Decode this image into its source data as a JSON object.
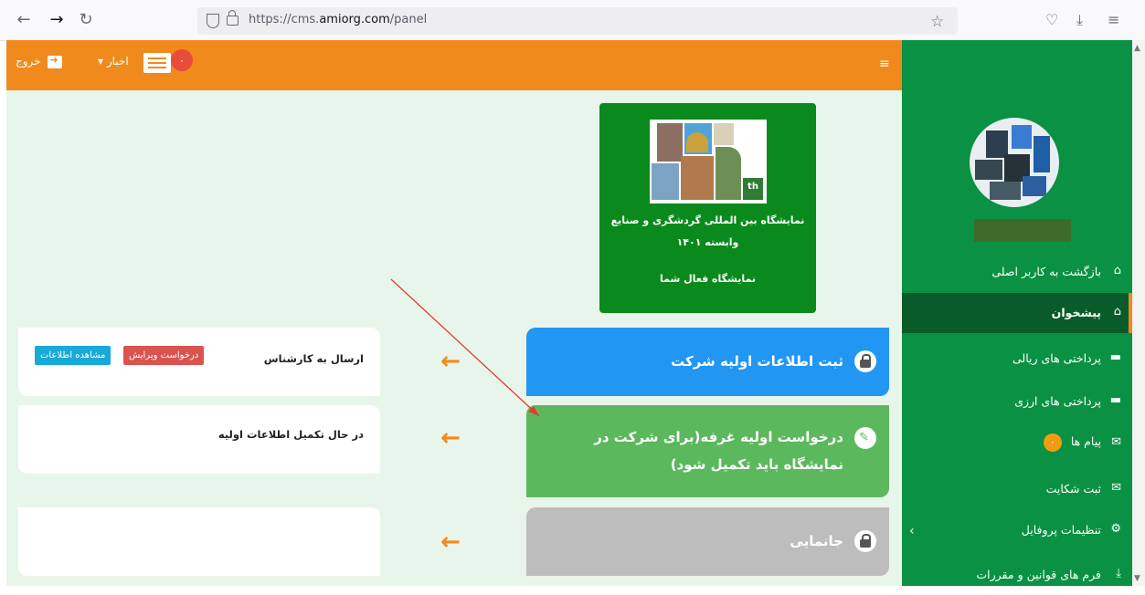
{
  "browser": {
    "url_prefix": "https://cms.",
    "url_domain": "amiorg.com",
    "url_path": "/panel"
  },
  "topbar": {
    "exit_label": "خروج",
    "news_label": "اخبار",
    "news_badge": "۰",
    "menu_icon": "hamburger-icon"
  },
  "exhibition": {
    "title_line1": "نمایشگاه بین المللی گردشگری و صنایع",
    "title_line2": "وابسته ۱۴۰۱",
    "status": "نمایشگاه فعال شما"
  },
  "steps": [
    {
      "label": "ثبت اطلاعات اولیه شرکت",
      "color": "#2196f3",
      "icon": "lock-icon"
    },
    {
      "label": "درخواست اولیه غرفه(برای شرکت در نمایشگاه باید تکمیل شود)",
      "color": "#5cb85c",
      "icon": "edit-icon"
    },
    {
      "label": "جانمایی",
      "color": "#bdbdbd",
      "icon": "lock-icon"
    }
  ],
  "cards": [
    {
      "status": "ارسال به کارشناس",
      "btn_edit": "درخواست ویرایش",
      "btn_view": "مشاهده اطلاعات"
    },
    {
      "status": "در حال تکمیل اطلاعات اولیه"
    },
    {
      "status": ""
    }
  ],
  "sidebar": {
    "items": [
      {
        "label": "بازگشت به کاربر اصلی",
        "icon": "home-icon"
      },
      {
        "label": "پیشخوان",
        "icon": "home-icon"
      },
      {
        "label": "پرداختی های ریالی",
        "icon": "card-icon"
      },
      {
        "label": "پرداختی های ارزی",
        "icon": "card-icon"
      },
      {
        "label": "پیام ها",
        "icon": "envelope-icon",
        "badge": "۰"
      },
      {
        "label": "ثبت شکایت",
        "icon": "envelope-icon"
      },
      {
        "label": "تنظیمات پروفایل",
        "icon": "gears-icon"
      },
      {
        "label": "فرم های قوانین و مقررات",
        "icon": "download-icon"
      }
    ]
  },
  "colors": {
    "sidebar": "#0a9143",
    "topbar": "#f08a1c",
    "content_bg": "#e8f5ea",
    "annotation_arrow": "#e53935"
  }
}
